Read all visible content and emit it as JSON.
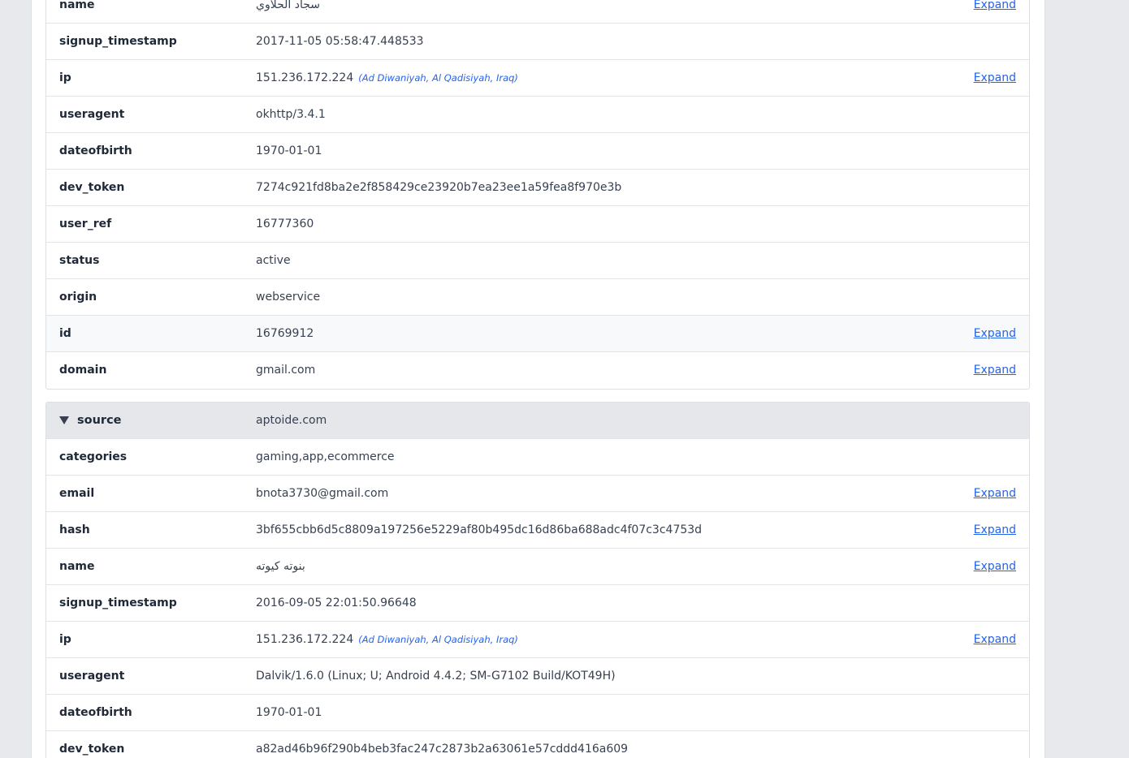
{
  "expand_label": "Expand",
  "record_a": {
    "rows": [
      {
        "key": "name",
        "value": "سجاد الحلاوي",
        "expand": true
      },
      {
        "key": "signup_timestamp",
        "value": "2017-11-05 05:58:47.448533"
      },
      {
        "key": "ip",
        "value": "151.236.172.224",
        "geo": "(Ad Diwaniyah, Al Qadisiyah, Iraq)",
        "expand": true
      },
      {
        "key": "useragent",
        "value": "okhttp/3.4.1"
      },
      {
        "key": "dateofbirth",
        "value": "1970-01-01"
      },
      {
        "key": "dev_token",
        "value": "7274c921fd8ba2e2f858429ce23920b7ea23ee1a59fea8f970e3b"
      },
      {
        "key": "user_ref",
        "value": "16777360"
      },
      {
        "key": "status",
        "value": "active"
      },
      {
        "key": "origin",
        "value": "webservice"
      },
      {
        "key": "id",
        "value": "16769912",
        "expand": true
      },
      {
        "key": "domain",
        "value": "gmail.com",
        "expand": true
      }
    ]
  },
  "record_b": {
    "header": {
      "key": "source",
      "value": "aptoide.com"
    },
    "rows": [
      {
        "key": "categories",
        "value": "gaming,app,ecommerce"
      },
      {
        "key": "email",
        "value": "bnota3730@gmail.com",
        "expand": true
      },
      {
        "key": "hash",
        "value": "3bf655cbb6d5c8809a197256e5229af80b495dc16d86ba688adc4f07c3c4753d",
        "expand": true
      },
      {
        "key": "name",
        "value": "بنوته كيوته",
        "expand": true
      },
      {
        "key": "signup_timestamp",
        "value": "2016-09-05 22:01:50.96648"
      },
      {
        "key": "ip",
        "value": "151.236.172.224",
        "geo": "(Ad Diwaniyah, Al Qadisiyah, Iraq)",
        "expand": true
      },
      {
        "key": "useragent",
        "value": "Dalvik/1.6.0 (Linux; U; Android 4.4.2; SM-G7102 Build/KOT49H)"
      },
      {
        "key": "dateofbirth",
        "value": "1970-01-01"
      },
      {
        "key": "dev_token",
        "value": "a82ad46b96f290b4beb3fac247c2873b2a63061e57cddd416a609"
      }
    ]
  }
}
